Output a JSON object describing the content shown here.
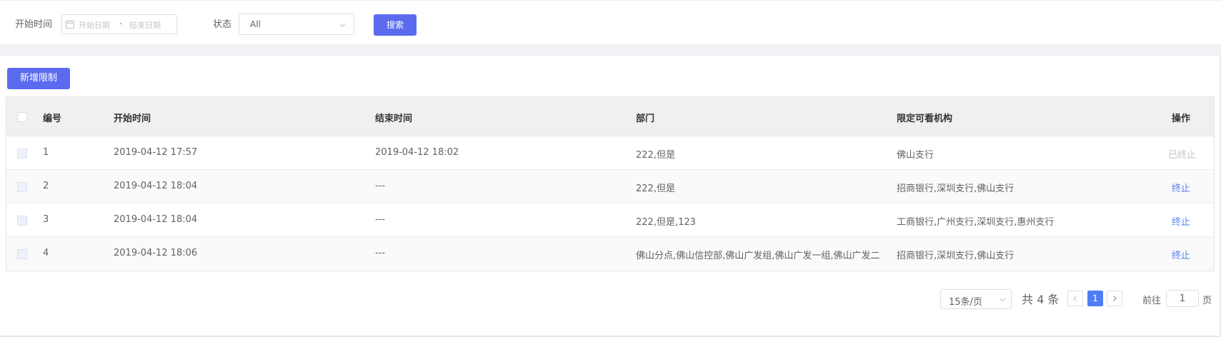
{
  "filter": {
    "start_time_label": "开始时间",
    "start_date_placeholder": "开始日期",
    "separator": "-",
    "end_date_placeholder": "结束日期",
    "status_label": "状态",
    "status_value": "All",
    "search_label": "搜索"
  },
  "toolbar": {
    "add_label": "新增限制"
  },
  "table": {
    "columns": [
      "编号",
      "开始时间",
      "结束时间",
      "部门",
      "限定可看机构",
      "操作"
    ],
    "rows": [
      {
        "id": "1",
        "start": "2019-04-12 17:57",
        "end": "2019-04-12 18:02",
        "dept": "222,但是",
        "orgs": "佛山支行",
        "action": "已终止"
      },
      {
        "id": "2",
        "start": "2019-04-12 18:04",
        "end": "---",
        "dept": "222,但是",
        "orgs": "招商银行,深圳支行,佛山支行",
        "action": "终止"
      },
      {
        "id": "3",
        "start": "2019-04-12 18:04",
        "end": "---",
        "dept": "222,但是,123",
        "orgs": "工商银行,广州支行,深圳支行,惠州支行",
        "action": "终止"
      },
      {
        "id": "4",
        "start": "2019-04-12 18:06",
        "end": "---",
        "dept": "佛山分点,佛山信控部,佛山广发组,佛山广发一组,佛山广发二",
        "orgs": "招商银行,深圳支行,佛山支行",
        "action": "终止"
      }
    ]
  },
  "pagination": {
    "page_size": "15条/页",
    "total": "共 4 条",
    "current_page": "1",
    "goto_label": "前往",
    "goto_value": "1",
    "page_unit": "页"
  },
  "colors": {
    "primary": "#5b6bf0",
    "link": "#4f7df5",
    "disabled": "#c0c4cc"
  }
}
